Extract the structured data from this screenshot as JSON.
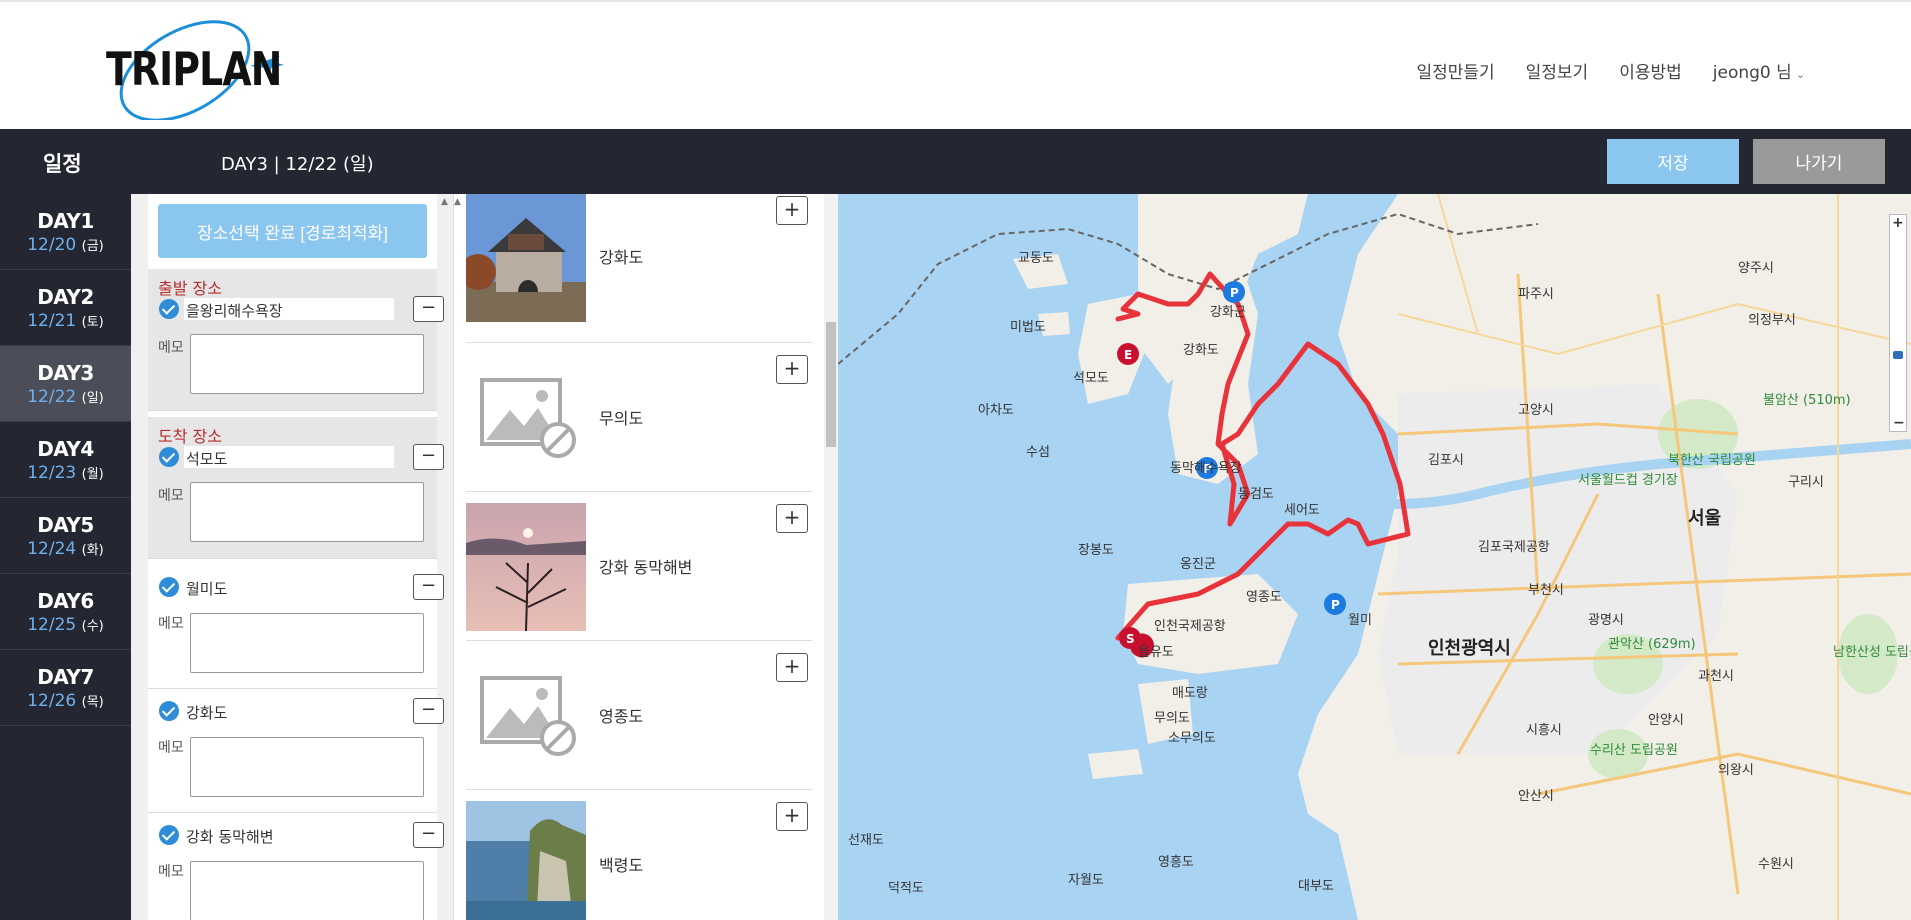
{
  "header": {
    "logo_text": "TRIPLAN",
    "nav": [
      "일정만들기",
      "일정보기",
      "이용방법",
      "jeong0 님"
    ]
  },
  "schedule_bar": {
    "title": "일정",
    "current_day": "DAY3 | 12/22 (일)",
    "save_label": "저장",
    "exit_label": "나가기"
  },
  "days": [
    {
      "name": "DAY1",
      "date": "12/20",
      "dow": "(금)"
    },
    {
      "name": "DAY2",
      "date": "12/21",
      "dow": "(토)"
    },
    {
      "name": "DAY3",
      "date": "12/22",
      "dow": "(일)"
    },
    {
      "name": "DAY4",
      "date": "12/23",
      "dow": "(월)"
    },
    {
      "name": "DAY5",
      "date": "12/24",
      "dow": "(화)"
    },
    {
      "name": "DAY6",
      "date": "12/25",
      "dow": "(수)"
    },
    {
      "name": "DAY7",
      "date": "12/26",
      "dow": "(목)"
    }
  ],
  "places": {
    "done_button": "장소선택 완료 [경로최적화]",
    "memo_label": "메모",
    "start_label": "출발 장소",
    "end_label": "도착 장소",
    "start": "을왕리해수욕장",
    "end": "석모도",
    "stops": [
      "월미도",
      "강화도",
      "강화 동막해변"
    ]
  },
  "results": [
    {
      "name": "강화도",
      "image": "gate-photo"
    },
    {
      "name": "무의도",
      "image": "placeholder"
    },
    {
      "name": "강화 동막해변",
      "image": "sunset-photo"
    },
    {
      "name": "영종도",
      "image": "placeholder"
    },
    {
      "name": "백령도",
      "image": "cliff-photo"
    }
  ],
  "map": {
    "labels": {
      "incheon": "인천광역시",
      "seoul": "서울",
      "ganghwa_gun": "강화군",
      "ganghwa_do": "강화도",
      "seokmodo": "석모도",
      "gyodongdo": "교동도",
      "mibeopdo": "미법도",
      "achado": "아차도",
      "suseom": "수섬",
      "dongmak": "동막해수욕장",
      "donggeomdo": "동검도",
      "seeodo": "세어도",
      "jangbongdo": "장봉도",
      "ongjin": "옹진군",
      "yeongjongdo": "영종도",
      "airport": "인천국제공항",
      "eurwangri": "을유도",
      "maedorang": "매도랑",
      "muuido": "무의도",
      "somuuido": "소무의도",
      "wolmi": "월미",
      "gimpo": "김포시",
      "goyang": "고양시",
      "paju": "파주시",
      "yangju": "양주시",
      "uijeongbu": "의정부시",
      "guri": "구리시",
      "bucheon": "부천시",
      "gwangmyeong": "광명시",
      "siheung": "시흥시",
      "ansan": "안산시",
      "anyang": "안양시",
      "gwacheon": "과천시",
      "uiwang": "의왕시",
      "suwon": "수원시",
      "seonjaedo": "선재도",
      "yeongheungdo": "영흥도",
      "jawoldo": "자월도",
      "deokjeokdo": "덕적도",
      "daebudo": "대부도",
      "gimpo_airport": "김포국제공항",
      "bukhansan": "북한산 국립공원",
      "gwanaksan": "관악산 (629m)",
      "bulamsan": "불암산 (510m)",
      "seoul_worldcup": "서울월드컵 경기장",
      "namhansanseong": "남한산성 도립공원",
      "surisan": "수리산 도립공원"
    },
    "route_color": "#e8333b",
    "markers": {
      "start": "S",
      "end": "E",
      "parking": "P"
    }
  }
}
